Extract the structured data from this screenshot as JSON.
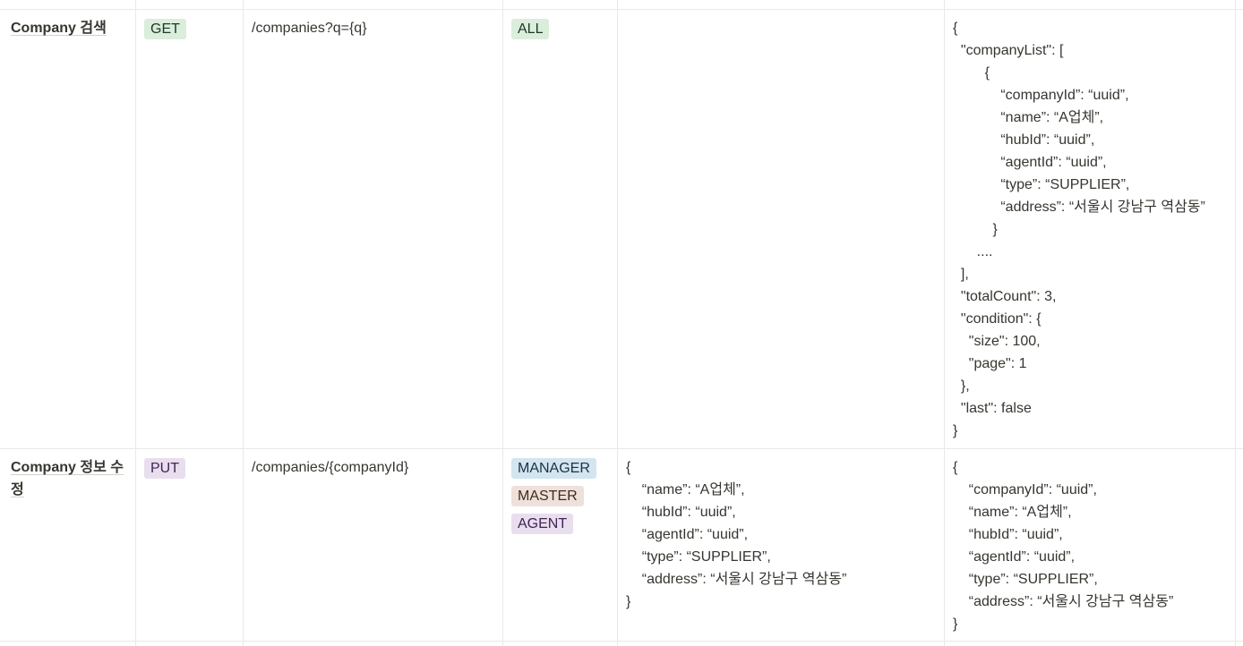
{
  "colors": {
    "green_tag_bg": "#dbeddb",
    "green_tag_fg": "#1c3829",
    "purple_tag_bg": "#e8deee",
    "purple_tag_fg": "#412454",
    "blue_tag_bg": "#d3e5ef",
    "blue_tag_fg": "#183347",
    "brown_tag_bg": "#eee0da",
    "brown_tag_fg": "#442a1e",
    "border": "#e9e9e7"
  },
  "rows": [
    {
      "name": "Company 검색",
      "method": {
        "label": "GET",
        "color": "green"
      },
      "path": "/companies?q={q}",
      "roles": [
        {
          "label": "ALL",
          "color": "green"
        }
      ],
      "request": [],
      "response": [
        "{",
        "  \"companyList\": [",
        "        {",
        "            “companyId”: “uuid”,",
        "            “name”: “A업체”,",
        "            “hubId”: “uuid”,",
        "            “agentId”: “uuid”,",
        "            “type”: “SUPPLIER”,",
        "            “address”: “서울시 강남구 역삼동”",
        "          }",
        "      ....",
        "  ],",
        "  \"totalCount\": 3,",
        "  \"condition\": {",
        "    \"size\": 100,",
        "    \"page\": 1",
        "  },",
        "  \"last\": false",
        "}"
      ]
    },
    {
      "name": "Company 정보 수정",
      "method": {
        "label": "PUT",
        "color": "purple"
      },
      "path": "/companies/{companyId}",
      "roles": [
        {
          "label": "MANAGER",
          "color": "blue"
        },
        {
          "label": "MASTER",
          "color": "brown"
        },
        {
          "label": "AGENT",
          "color": "purple"
        }
      ],
      "request": [
        "{",
        "    “name”: “A업체”,",
        "    “hubId”: “uuid”,",
        "    “agentId”: “uuid”,",
        "    “type”: “SUPPLIER”,",
        "    “address”: “서울시 강남구 역삼동”",
        "}"
      ],
      "response": [
        "{",
        "    “companyId”: “uuid”,",
        "    “name”: “A업체”,",
        "    “hubId”: “uuid”,",
        "    “agentId”: “uuid”,",
        "    “type”: “SUPPLIER”,",
        "    “address”: “서울시 강남구 역삼동”",
        "}"
      ]
    }
  ]
}
